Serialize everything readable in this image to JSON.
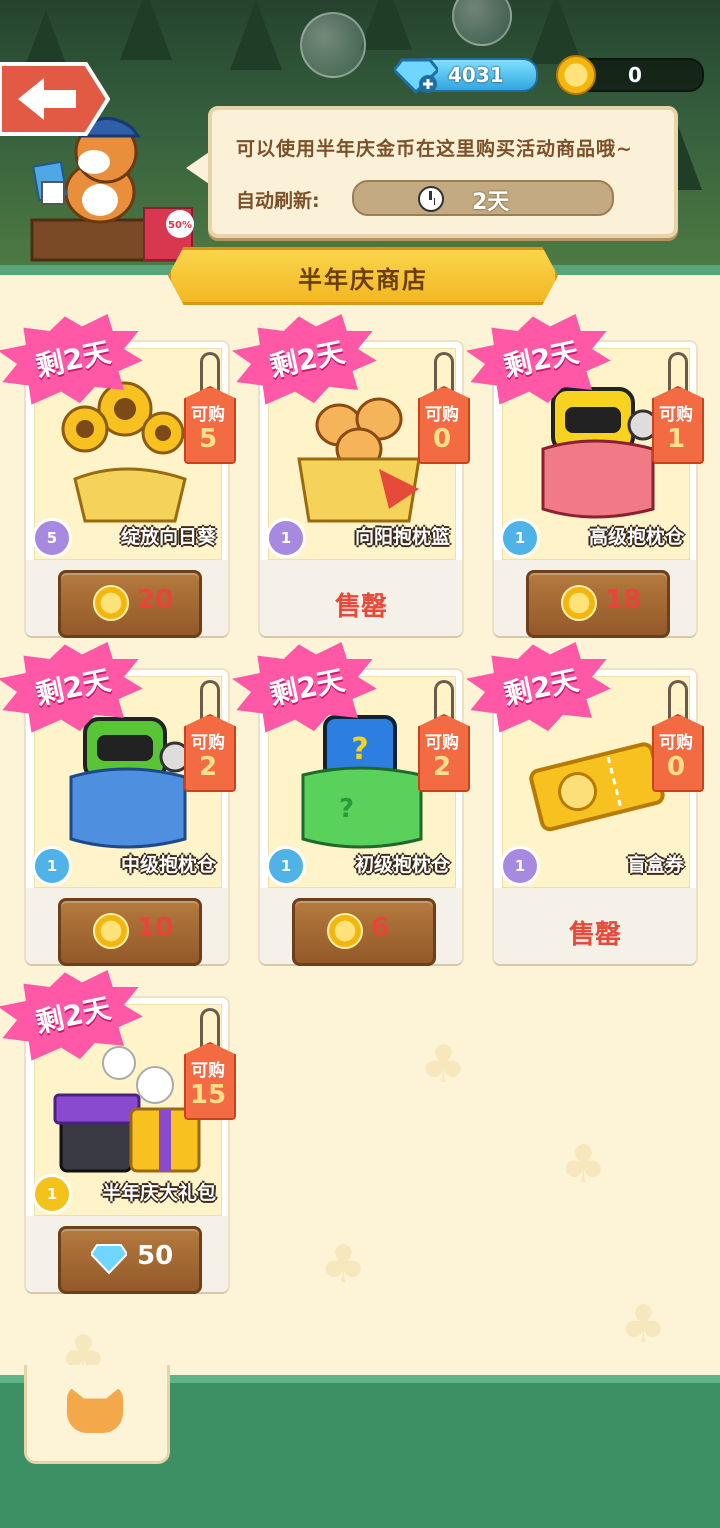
{
  "currency": {
    "gems": "4031",
    "coins": "0"
  },
  "info": {
    "tip": "可以使用半年庆金币在这里购买活动商品哦~",
    "refresh_label": "自动刷新:",
    "refresh_value": "2天"
  },
  "shop": {
    "title": "半年庆商店",
    "remain_label": "剩2天",
    "limit_label": "可购",
    "sold_out": "售罄"
  },
  "items": [
    {
      "name": "绽放向日葵",
      "limit": "5",
      "level": "5",
      "price": "20",
      "currency": "coin",
      "sold_out": false,
      "level_color": "#a889e0"
    },
    {
      "name": "向阳抱枕篮",
      "limit": "0",
      "level": "1",
      "price": "",
      "currency": "coin",
      "sold_out": true,
      "level_color": "#a889e0"
    },
    {
      "name": "高级抱枕仓",
      "limit": "1",
      "level": "1",
      "price": "18",
      "currency": "coin",
      "sold_out": false,
      "level_color": "#4fb3e8"
    },
    {
      "name": "中级抱枕仓",
      "limit": "2",
      "level": "1",
      "price": "10",
      "currency": "coin",
      "sold_out": false,
      "level_color": "#4fb3e8"
    },
    {
      "name": "初级抱枕仓",
      "limit": "2",
      "level": "1",
      "price": "6",
      "currency": "coin",
      "sold_out": false,
      "level_color": "#4fb3e8"
    },
    {
      "name": "盲盒券",
      "limit": "0",
      "level": "1",
      "price": "",
      "currency": "coin",
      "sold_out": true,
      "level_color": "#a889e0"
    },
    {
      "name": "半年庆大礼包",
      "limit": "15",
      "level": "1",
      "price": "50",
      "currency": "gem",
      "sold_out": false,
      "level_color": "#f3c21b"
    }
  ],
  "colors": {
    "price_red": "#e8443a",
    "price_white": "#ffffff",
    "accent_green": "#3d8f64"
  },
  "icons": {
    "back": "back-arrow-icon",
    "gem": "diamond-icon",
    "coin": "coin-icon",
    "clock": "clock-icon",
    "tab": "cat-head-icon"
  }
}
